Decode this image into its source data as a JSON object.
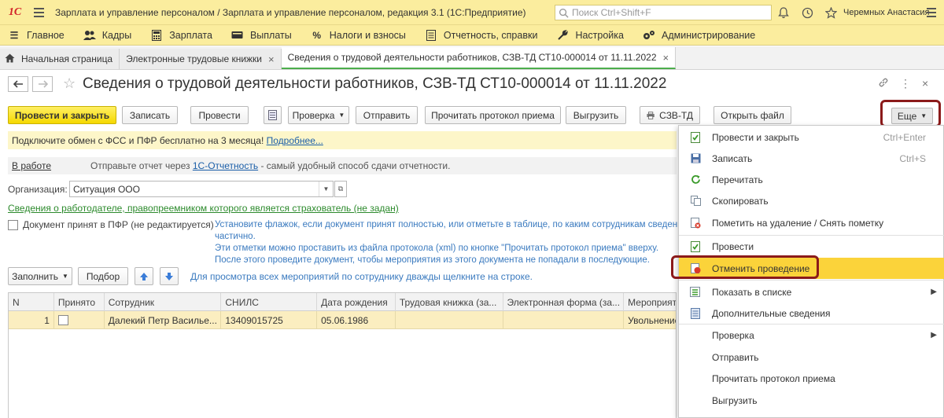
{
  "titlebar": {
    "logo": "1С",
    "title": "Зарплата и управление персоналом / Зарплата и управление персоналом, редакция 3.1  (1С:Предприятие)",
    "search_placeholder": "Поиск Ctrl+Shift+F",
    "user": "Черемных Анастасия"
  },
  "sections": [
    {
      "label": "Главное",
      "icon": "menu-lines-icon"
    },
    {
      "label": "Кадры",
      "icon": "people-icon"
    },
    {
      "label": "Зарплата",
      "icon": "calculator-icon"
    },
    {
      "label": "Выплаты",
      "icon": "wallet-icon"
    },
    {
      "label": "Налоги и взносы",
      "icon": "percent-icon"
    },
    {
      "label": "Отчетность, справки",
      "icon": "report-icon"
    },
    {
      "label": "Настройка",
      "icon": "wrench-icon"
    },
    {
      "label": "Администрирование",
      "icon": "gears-icon"
    }
  ],
  "tabs": [
    {
      "label": "Начальная страница"
    },
    {
      "label": "Электронные трудовые книжки"
    },
    {
      "label": "Сведения о трудовой деятельности работников, СЗВ-ТД СТ10-000014 от 11.11.2022"
    }
  ],
  "document": {
    "title": "Сведения о трудовой деятельности работников, СЗВ-ТД СТ10-000014 от 11.11.2022"
  },
  "toolbar": {
    "post_close": "Провести и закрыть",
    "save": "Записать",
    "post": "Провести",
    "check": "Проверка",
    "send": "Отправить",
    "read_protocol": "Прочитать протокол приема",
    "upload": "Выгрузить",
    "szv_td": "СЗВ-ТД",
    "open_file": "Открыть файл",
    "more": "Еще"
  },
  "banner": {
    "text": "Подключите обмен с ФСС и ПФР бесплатно на 3 месяца!",
    "link": "Подробнее..."
  },
  "status": {
    "state": "В работе",
    "hint_before": "Отправьте отчет через",
    "hint_link": "1С-Отчетность",
    "hint_after": "- самый удобный способ сдачи отчетности."
  },
  "organization": {
    "label": "Организация:",
    "value": "Ситуация ООО"
  },
  "employer_link": "Сведения о работодателе, правопреемником которого является страхователь (не задан)",
  "accepted": {
    "label": "Документ принят в ПФР (не редактируется)",
    "note_lines": [
      "Установите флажок, если документ принят полностью, или отметьте в таблице, по каким сотрудникам сведения",
      "частично.",
      "Эти отметки можно проставить из файла протокола (xml) по кнопке \"Прочитать протокол приема\" вверху.",
      "После этого проведите документ, чтобы мероприятия из этого документа не попадали в последующие."
    ]
  },
  "list_toolbar": {
    "fill": "Заполнить",
    "select": "Подбор",
    "hint": "Для просмотра всех мероприятий по сотруднику дважды щелкните на строке."
  },
  "table": {
    "columns": [
      "N",
      "Принято",
      "Сотрудник",
      "СНИЛС",
      "Дата рождения",
      "Трудовая книжка (за...",
      "Электронная форма (за...",
      "Мероприят"
    ],
    "rows": [
      {
        "n": "1",
        "employee": "Далекий Петр Василье...",
        "snils": "13409015725",
        "birth": "05.06.1986",
        "book": "",
        "eform": "",
        "event": "Увольнение"
      }
    ]
  },
  "menu": {
    "items": [
      {
        "label": "Провести и закрыть",
        "shortcut": "Ctrl+Enter",
        "icon": "post-close-icon"
      },
      {
        "label": "Записать",
        "shortcut": "Ctrl+S",
        "icon": "save-icon"
      },
      {
        "label": "Перечитать",
        "shortcut": "",
        "icon": "refresh-icon"
      },
      {
        "label": "Скопировать",
        "shortcut": "",
        "icon": "copy-icon"
      },
      {
        "label": "Пометить на удаление / Снять пометку",
        "shortcut": "",
        "icon": "delete-mark-icon"
      },
      {
        "label": "Провести",
        "shortcut": "",
        "icon": "post-icon"
      },
      {
        "label": "Отменить проведение",
        "shortcut": "",
        "icon": "cancel-post-icon"
      },
      {
        "label": "Показать в списке",
        "shortcut": "",
        "icon": "show-list-icon"
      },
      {
        "label": "Дополнительные сведения",
        "shortcut": "",
        "icon": "details-icon"
      },
      {
        "label": "Проверка",
        "shortcut": "",
        "icon": ""
      },
      {
        "label": "Отправить",
        "shortcut": "",
        "icon": ""
      },
      {
        "label": "Прочитать протокол приема",
        "shortcut": "",
        "icon": ""
      },
      {
        "label": "Выгрузить",
        "shortcut": "",
        "icon": ""
      }
    ]
  },
  "colors": {
    "accent": "#fbed9e",
    "primary_button": "#f5d800",
    "highlight": "#fbd33a",
    "outline": "#8b1a1a",
    "link": "#1a5ea8",
    "green_link": "#2c8a2c"
  }
}
